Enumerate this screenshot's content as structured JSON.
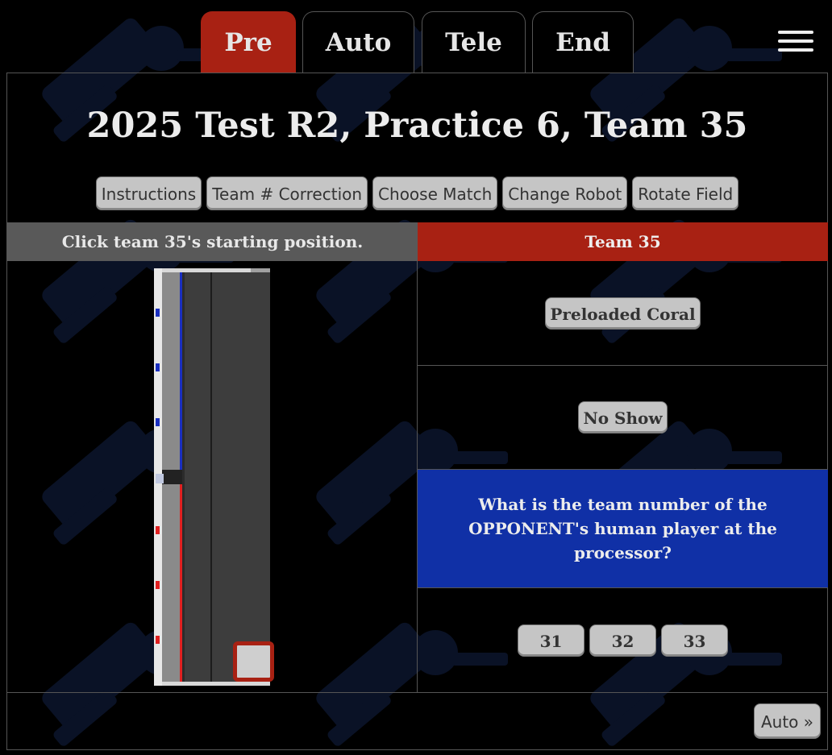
{
  "tabs": [
    {
      "label": "Pre",
      "active": true
    },
    {
      "label": "Auto",
      "active": false
    },
    {
      "label": "Tele",
      "active": false
    },
    {
      "label": "End",
      "active": false
    }
  ],
  "menu_icon": "hamburger-menu-icon",
  "title": "2025 Test R2, Practice 6, Team 35",
  "toolbar": [
    "Instructions",
    "Team # Correction",
    "Choose Match",
    "Change Robot",
    "Rotate Field"
  ],
  "left_panel": {
    "header": "Click team 35's starting position."
  },
  "right_panel": {
    "header": "Team 35",
    "preloaded_button": "Preloaded Coral",
    "no_show_button": "No Show",
    "question": "What is the team number of the OPPONENT's human player at the processor?",
    "options": [
      "31",
      "32",
      "33"
    ]
  },
  "next_button": "Auto »",
  "colors": {
    "active_tab": "#a82113",
    "team_header": "#a82113",
    "question_bg": "#1030a6",
    "button_bg": "#c5c5c5",
    "background": "#000000"
  }
}
